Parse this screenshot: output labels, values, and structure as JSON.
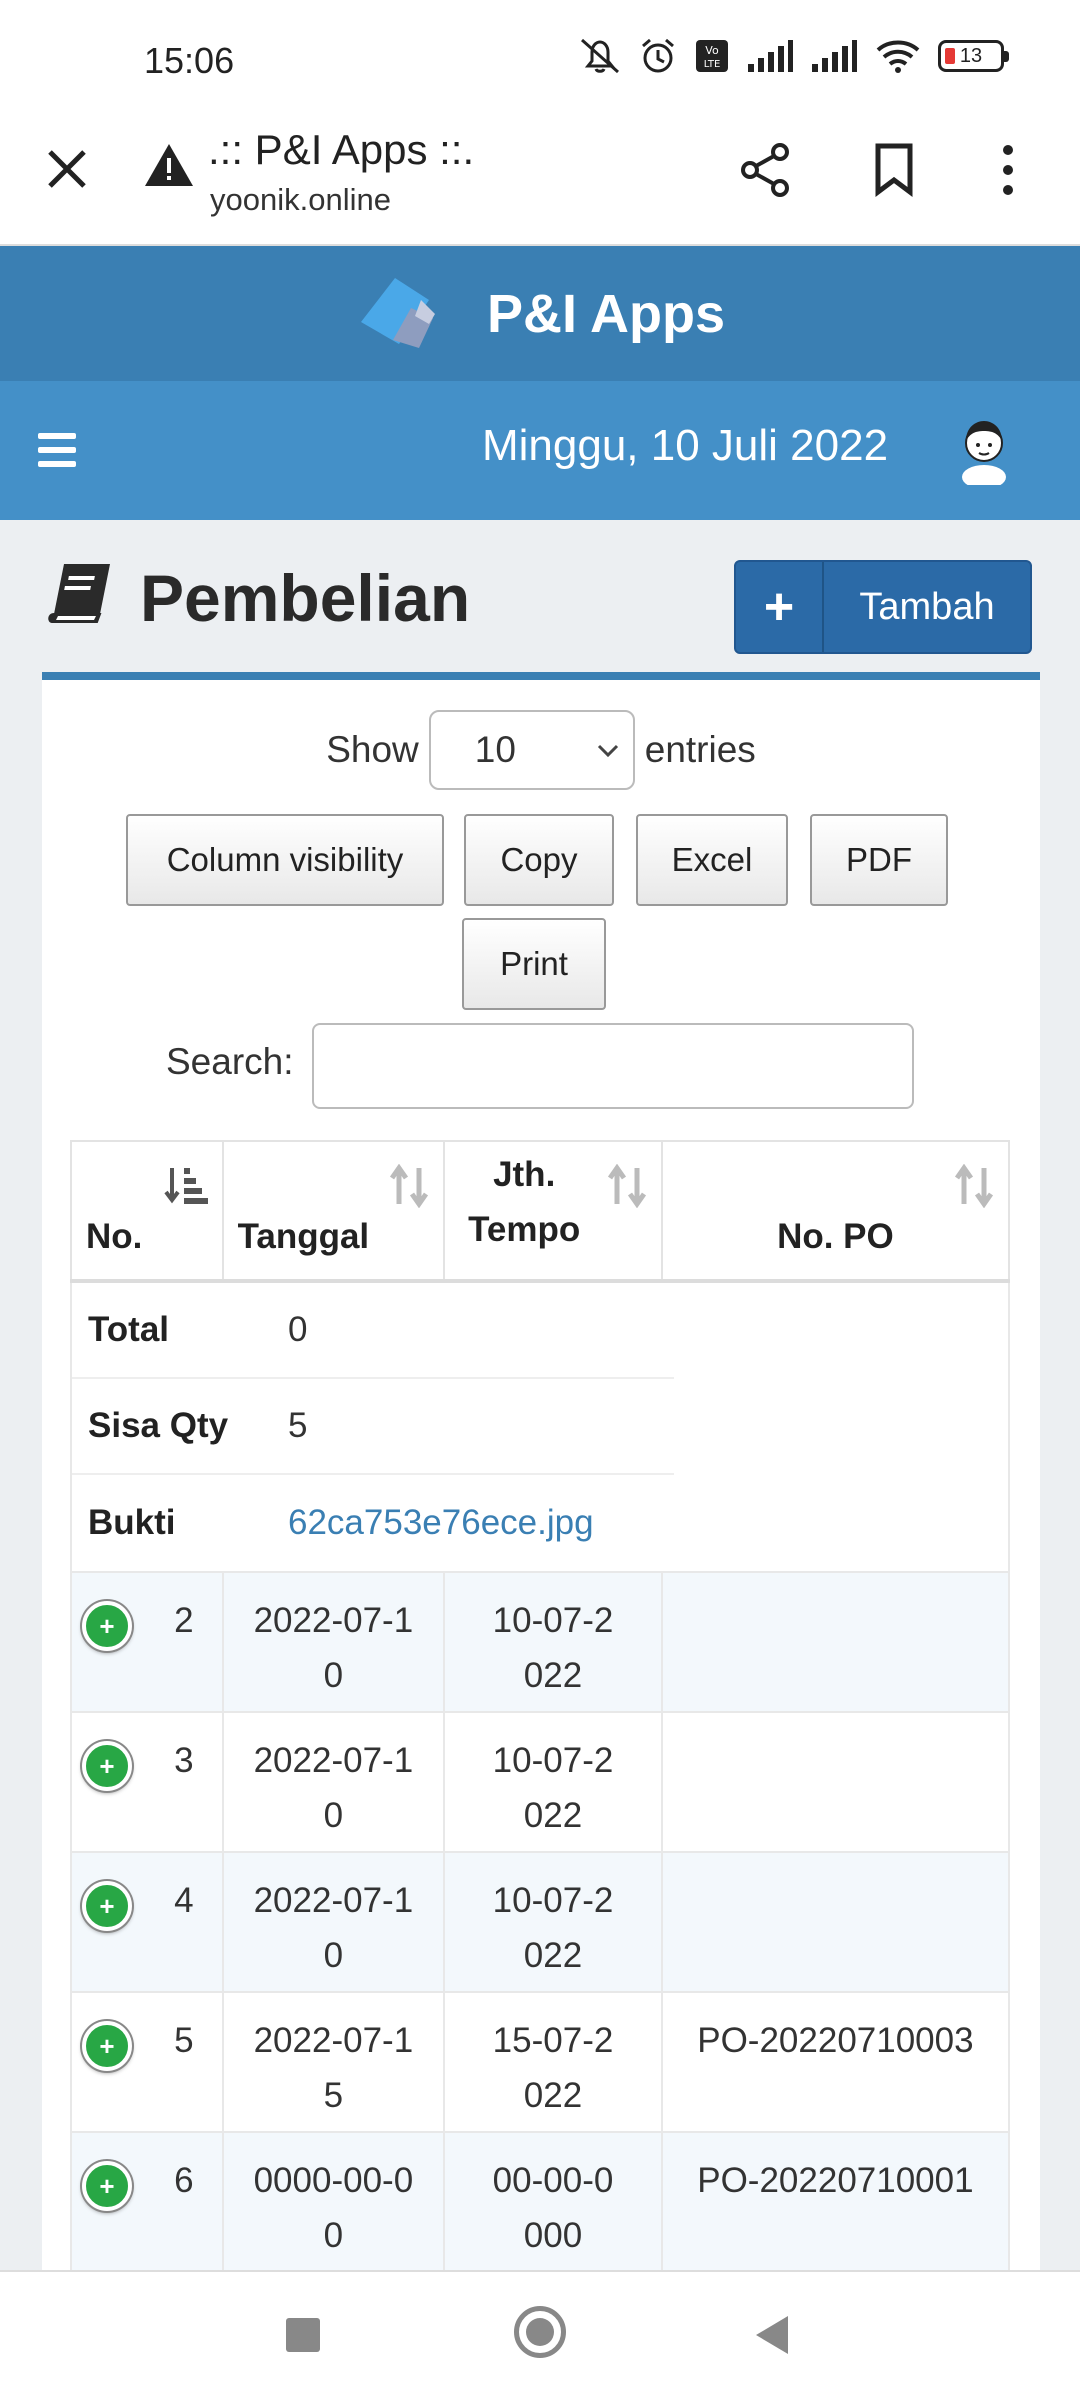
{
  "status_bar": {
    "time": "15:06",
    "battery": "13"
  },
  "browser": {
    "title": ".:: P&I Apps ::.",
    "url": "yoonik.online",
    "icons": [
      "close-icon",
      "warning-icon",
      "share-icon",
      "bookmark-icon",
      "more-vert-icon"
    ]
  },
  "app": {
    "name": "P&I Apps",
    "date": "Minggu, 10 Juli 2022",
    "brand_color": "#3a7fb3",
    "nav_color": "#4490c8"
  },
  "page": {
    "title": "Pembelian",
    "add_button_label": "Tambah",
    "add_button_icon": "plus-icon",
    "title_icon": "book-icon"
  },
  "datatable": {
    "show_label": "Show",
    "entries_value": "10",
    "entries_label": "entries",
    "buttons": [
      "Column visibility",
      "Copy",
      "Excel",
      "PDF",
      "Print"
    ],
    "search_label": "Search:",
    "search_value": "",
    "columns": [
      {
        "label": "No."
      },
      {
        "label": "Tanggal"
      },
      {
        "label": "Jth. Tempo"
      },
      {
        "label": "No. PO"
      }
    ],
    "child_details": [
      {
        "key": "Total",
        "value": "0"
      },
      {
        "key": "Sisa Qty",
        "value": "5"
      },
      {
        "key": "Bukti",
        "value": "62ca753e76ece.jpg"
      }
    ],
    "rows": [
      {
        "no": "2",
        "tanggal": "2022-07-10",
        "tempo": "10-07-2022",
        "po": ""
      },
      {
        "no": "3",
        "tanggal": "2022-07-10",
        "tempo": "10-07-2022",
        "po": ""
      },
      {
        "no": "4",
        "tanggal": "2022-07-10",
        "tempo": "10-07-2022",
        "po": ""
      },
      {
        "no": "5",
        "tanggal": "2022-07-15",
        "tempo": "15-07-2022",
        "po": "PO-20220710003"
      },
      {
        "no": "6",
        "tanggal": "0000-00-00",
        "tempo": "00-00-0000",
        "po": "PO-20220710001"
      }
    ],
    "expand_icon": "plus-circle-icon",
    "success_color": "#28a745"
  },
  "android_nav": {
    "icons": [
      "recents-icon",
      "home-icon",
      "back-icon"
    ]
  }
}
